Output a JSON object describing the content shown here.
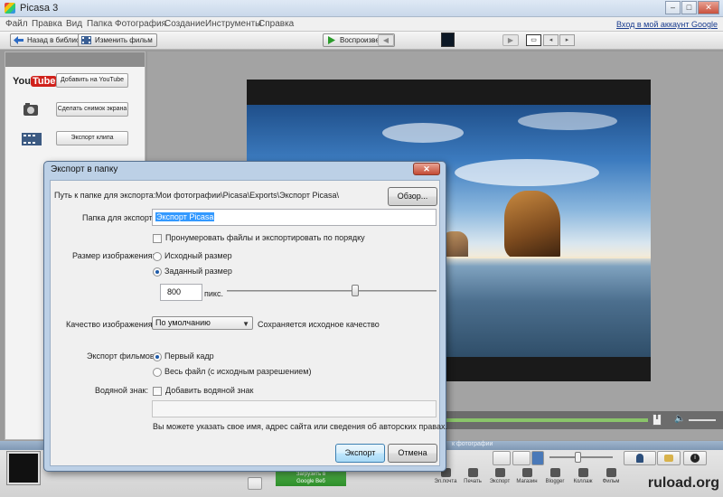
{
  "window": {
    "title": "Picasa 3",
    "minimize": "–",
    "maximize": "□",
    "close": "✕"
  },
  "menu": {
    "items": [
      "Файл",
      "Правка",
      "Вид",
      "Папка",
      "Фотография",
      "Создание",
      "Инструменты",
      "Справка"
    ],
    "signin": "Вход в мой аккаунт Google"
  },
  "toolbar": {
    "back_label": "Назад в библиотеку",
    "edit_film_label": "Изменить фильм",
    "play_label": "Воспроизвести"
  },
  "left_panel": {
    "actions": [
      {
        "icon": "youtube-logo",
        "label": "Добавить на YouTube"
      },
      {
        "icon": "camera-icon",
        "label": "Сделать снимок экрана"
      },
      {
        "icon": "film-icon",
        "label": "Экспорт клипа"
      }
    ]
  },
  "dialog": {
    "title": "Экспорт в папку",
    "close_label": "✕",
    "path_label": "Путь к папке для экспорта:",
    "path_value": "Мои фотографии\\Picasa\\Exports\\Экспорт Picasa\\",
    "browse_label": "Обзор...",
    "folder_label": "Папка для экспорта:",
    "folder_value": "Экспорт Picasa",
    "renumber_label": "Пронумеровать файлы и экспортировать по порядку",
    "renumber_checked": false,
    "image_size_label": "Размер изображения:",
    "size_options": [
      {
        "label": "Исходный размер",
        "selected": false
      },
      {
        "label": "Заданный размер",
        "selected": true
      }
    ],
    "pixels_value": "800",
    "pixels_unit": "пикс.",
    "size_slider_fraction": 0.61,
    "quality_label": "Качество изображения:",
    "quality_selected": "По умолчанию",
    "quality_note": "Сохраняется исходное качество",
    "film_export_label": "Экспорт фильмов:",
    "film_options": [
      {
        "label": "Первый кадр",
        "selected": true
      },
      {
        "label": "Весь файл (с исходным разрешением)",
        "selected": false
      }
    ],
    "watermark_label": "Водяной знак:",
    "watermark_checkbox_label": "Добавить водяной знак",
    "watermark_checked": false,
    "watermark_value": "",
    "watermark_hint": "Вы можете указать свое имя, адрес сайта или сведения об авторских правах.",
    "export_button": "Экспорт",
    "cancel_button": "Отмена"
  },
  "tray": {
    "selection_label": "к фотографии",
    "upload_google_line1": "Загрузить в",
    "upload_google_line2": "Google Веб",
    "actions": [
      "Эл.почта",
      "Печать",
      "Экспорт",
      "Магазин",
      "Blogger",
      "Коллаж",
      "Фильм"
    ]
  },
  "watermark": "ruload.org",
  "colors": {
    "accent_blue": "#3399ff",
    "dialog_frame": "#bcd0e6",
    "youtube_red": "#d0211b",
    "google_green": "#2e8d2a"
  }
}
